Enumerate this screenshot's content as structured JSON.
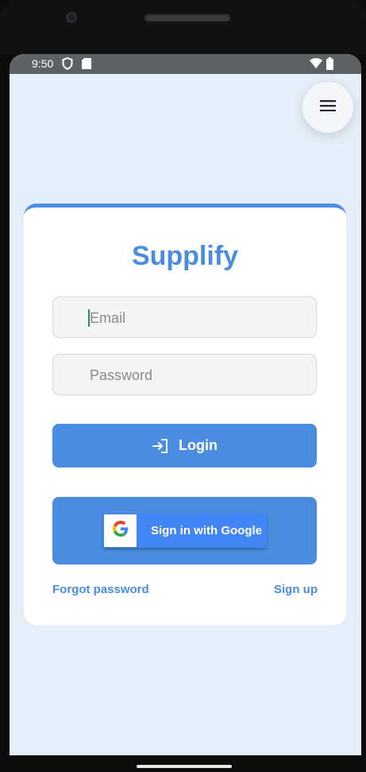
{
  "status_bar": {
    "time": "9:50",
    "icons": [
      "shield-icon",
      "sd-card-icon",
      "wifi-icon",
      "battery-icon"
    ]
  },
  "menu_button": {
    "icon": "hamburger-menu-icon"
  },
  "login_card": {
    "title": "Supplify",
    "email": {
      "placeholder": "Email",
      "value": ""
    },
    "password": {
      "placeholder": "Password",
      "value": ""
    },
    "login_button": {
      "label": "Login",
      "icon": "login-arrow-icon"
    },
    "google_button": {
      "label": "Sign in with Google",
      "icon": "google-g-icon"
    },
    "forgot_password_link": "Forgot password",
    "sign_up_link": "Sign up"
  },
  "colors": {
    "brand": "#4a8de0",
    "screen_background": "#e6eff9",
    "card_background": "#ffffff",
    "google_blue": "#4285f4"
  }
}
